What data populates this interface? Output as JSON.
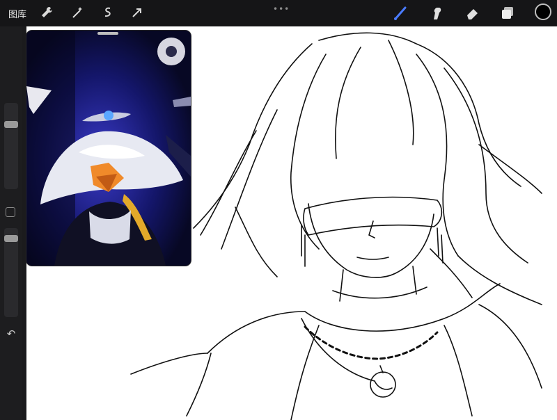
{
  "toolbar": {
    "gallery_label": "图库",
    "left_tools": [
      "wrench-icon",
      "magic-wand-icon",
      "selection-icon",
      "transform-arrow-icon"
    ],
    "center_indicator": "•••",
    "right_tools": [
      "brush-icon",
      "smudge-icon",
      "eraser-icon",
      "layers-icon"
    ],
    "current_color": "#000000",
    "accent_color": "#4a7bff"
  },
  "sidebar": {
    "brush_size_level": 0.2,
    "opacity_level": 0.15,
    "undo_icon": "undo-icon"
  },
  "reference_window": {
    "subject": "reference-image"
  }
}
